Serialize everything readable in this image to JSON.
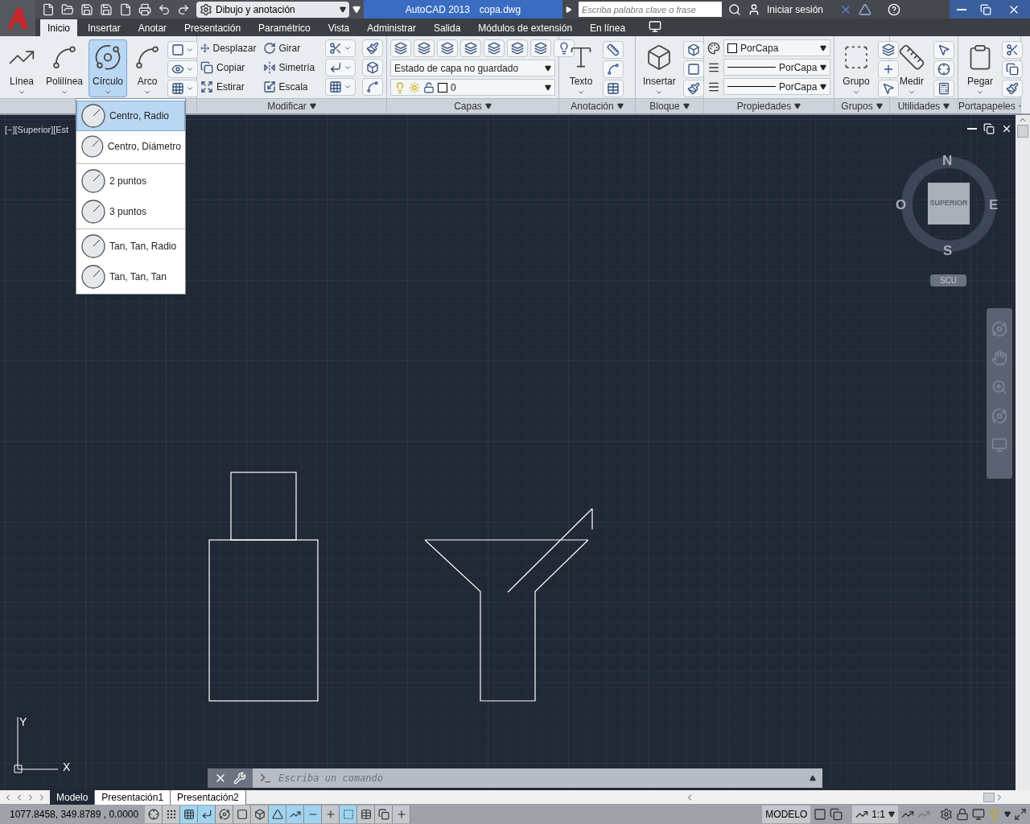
{
  "title_bar": {
    "workspace": "Dibujo y anotación",
    "title": "AutoCAD 2013",
    "file": "copa.dwg",
    "search": {
      "placeholder": "Escriba palabra clave o frase"
    },
    "sign_in": "Iniciar sesión"
  },
  "tabs": [
    {
      "label": "Inicio",
      "selected": true
    },
    {
      "label": "Insertar",
      "selected": false
    },
    {
      "label": "Anotar",
      "selected": false
    },
    {
      "label": "Presentación",
      "selected": false
    },
    {
      "label": "Paramétrico",
      "selected": false
    },
    {
      "label": "Vista",
      "selected": false
    },
    {
      "label": "Administrar",
      "selected": false
    },
    {
      "label": "Salida",
      "selected": false
    },
    {
      "label": "Módulos de extensión",
      "selected": false
    },
    {
      "label": "En línea",
      "selected": false
    }
  ],
  "ribbon": {
    "panels": [
      {
        "kind": "draw",
        "buttons": [
          {
            "label": "Línea",
            "selected": false
          },
          {
            "label": "Polilínea",
            "selected": false
          },
          {
            "label": "Círculo",
            "selected": true
          },
          {
            "label": "Arco",
            "selected": false
          }
        ]
      },
      {
        "kind": "modify",
        "title": "Modificar",
        "tools": [
          "Desplazar",
          "Girar",
          "Copiar",
          "Simetría",
          "Estirar",
          "Escala"
        ]
      },
      {
        "kind": "layers",
        "title": "Capas",
        "layer_state": "Estado de capa no guardado",
        "layer": "0"
      },
      {
        "kind": "big",
        "title": "Anotación",
        "button": "Texto"
      },
      {
        "kind": "big",
        "title": "Bloque",
        "button": "Insertar"
      },
      {
        "kind": "properties",
        "title": "Propiedades",
        "values": [
          "PorCapa",
          "PorCapa",
          "PorCapa"
        ]
      },
      {
        "kind": "big",
        "title": "Grupos",
        "button": "Grupo"
      },
      {
        "kind": "big",
        "title": "Utilidades",
        "button": "Medir"
      },
      {
        "kind": "big",
        "title": "Portapapeles",
        "button": "Pegar"
      }
    ]
  },
  "circle_menu": {
    "groups": [
      {
        "items": [
          {
            "label": "Centro, Radio",
            "selected": true
          },
          {
            "label": "Centro, Diámetro",
            "selected": false
          }
        ]
      },
      {
        "items": [
          {
            "label": "2 puntos",
            "selected": false
          },
          {
            "label": "3 puntos",
            "selected": false
          }
        ]
      },
      {
        "items": [
          {
            "label": "Tan, Tan, Radio",
            "selected": false
          },
          {
            "label": "Tan, Tan, Tan",
            "selected": false
          }
        ]
      }
    ]
  },
  "viewport": {
    "label": "[−][Superior][Est",
    "compass": {
      "north": "N",
      "west": "O",
      "east": "E",
      "south": "S",
      "face": "SUPERIOR"
    },
    "ucs_button": "SCU",
    "axis": {
      "y": "Y",
      "x": "X"
    }
  },
  "command_line": {
    "placeholder": "Escriba un comando"
  },
  "layout_tabs": [
    {
      "label": "Modelo",
      "selected": true
    },
    {
      "label": "Presentación1",
      "selected": false
    },
    {
      "label": "Presentación2",
      "selected": false
    }
  ],
  "status_bar": {
    "coordinates": "1077.8458, 349.8789 , 0.0000",
    "toggles": [
      {
        "on": false
      },
      {
        "on": false
      },
      {
        "on": true
      },
      {
        "on": true
      },
      {
        "on": false
      },
      {
        "on": false
      },
      {
        "on": false
      },
      {
        "on": true
      },
      {
        "on": true
      },
      {
        "on": true
      },
      {
        "on": false
      },
      {
        "on": true
      },
      {
        "on": false
      },
      {
        "on": false
      },
      {
        "on": false
      }
    ],
    "space": "MODELO",
    "scale": "1:1"
  }
}
